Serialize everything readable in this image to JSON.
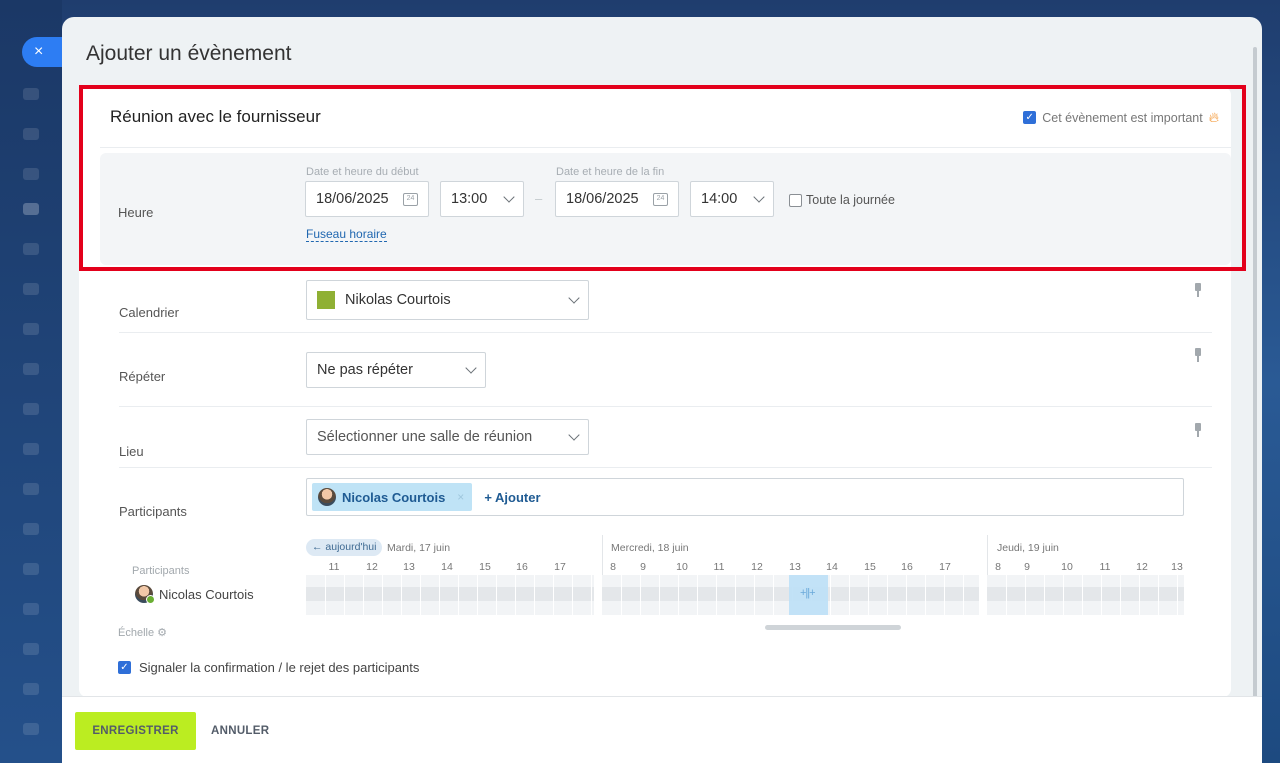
{
  "window": {
    "title": "Ajouter un évènement",
    "close_symbol": "×"
  },
  "event": {
    "title": "Réunion avec le fournisseur",
    "important_label": "Cet évènement est important",
    "important_checked": true
  },
  "time": {
    "row_label": "Heure",
    "start_label": "Date et heure du début",
    "end_label": "Date et heure de la fin",
    "start_date": "18/06/2025",
    "start_time": "13:00",
    "end_date": "18/06/2025",
    "end_time": "14:00",
    "separator": "–",
    "all_day_label": "Toute la journée",
    "all_day_checked": false,
    "timezone_link": "Fuseau horaire",
    "calendar_icon_text": "24"
  },
  "calendar": {
    "row_label": "Calendrier",
    "value": "Nikolas Courtois",
    "color": "#8fb034"
  },
  "repeat": {
    "row_label": "Répéter",
    "value": "Ne pas répéter"
  },
  "location": {
    "row_label": "Lieu",
    "placeholder": "Sélectionner une salle de réunion"
  },
  "participants": {
    "row_label": "Participants",
    "chip_name": "Nicolas Courtois",
    "chip_remove": "×",
    "add_label": "+ Ajouter"
  },
  "planner": {
    "today_label": "← aujourd'hui",
    "participants_header": "Participants",
    "participant_name": "Nicolas Courtois",
    "scale_label": "Échelle",
    "selection_handle": "+||+",
    "days": [
      {
        "label": "Mardi, 17 juin",
        "hours": [
          "11",
          "12",
          "13",
          "14",
          "15",
          "16",
          "17"
        ]
      },
      {
        "label": "Mercredi, 18 juin",
        "hours": [
          "8",
          "9",
          "10",
          "11",
          "12",
          "13",
          "14",
          "15",
          "16",
          "17"
        ]
      },
      {
        "label": "Jeudi, 19 juin",
        "hours": [
          "8",
          "9",
          "10",
          "11",
          "12",
          "13"
        ]
      }
    ]
  },
  "confirm": {
    "label": "Signaler la confirmation / le rejet des participants",
    "checked": true
  },
  "footer": {
    "save_label": "ENREGISTRER",
    "cancel_label": "ANNULER"
  },
  "colors": {
    "accent": "#2f6fd8",
    "save_button": "#bbed21",
    "highlight_border": "#e3001b",
    "selection": "#bfe0f7"
  }
}
